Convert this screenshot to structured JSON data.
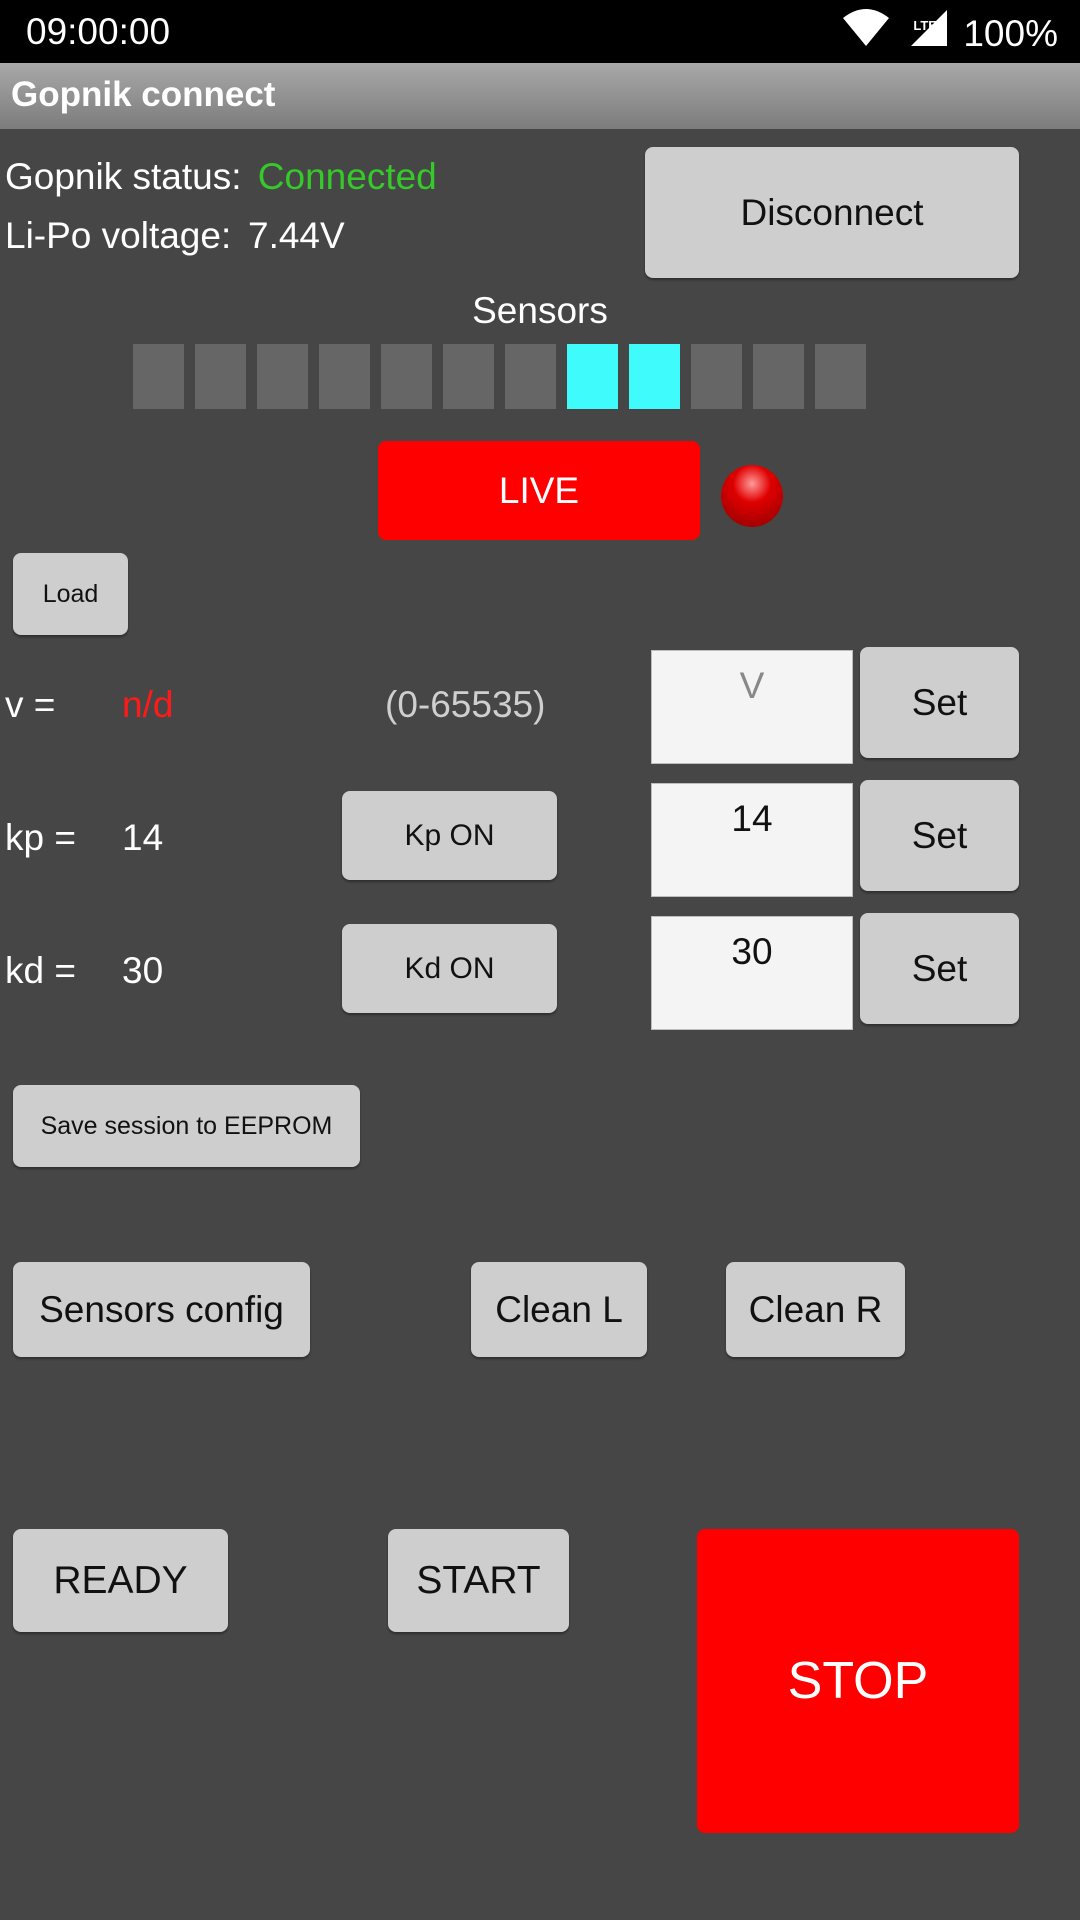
{
  "status_bar": {
    "time": "09:00:00",
    "network": "LTE",
    "battery": "100%",
    "icons": [
      "wifi-icon",
      "signal-icon"
    ]
  },
  "app": {
    "title": "Gopnik connect"
  },
  "info": {
    "status_label": "Gopnik status:",
    "status_value": "Connected",
    "voltage_label": "Li-Po voltage:",
    "voltage_value": "7.44V"
  },
  "disconnect_label": "Disconnect",
  "sensors": {
    "title": "Sensors",
    "states": [
      false,
      false,
      false,
      false,
      false,
      false,
      false,
      true,
      true,
      false,
      false,
      false
    ]
  },
  "live": {
    "label": "LIVE",
    "indicator_color": "#e00000"
  },
  "load_label": "Load",
  "params": {
    "v_label": "v =",
    "v_value": "n/d",
    "v_range": "(0-65535)",
    "v_placeholder": "V",
    "kp_label": "kp =",
    "kp_value": "14",
    "kp_toggle": "Kp ON",
    "kp_input": "14",
    "kd_label": "kd =",
    "kd_value": "30",
    "kd_toggle": "Kd ON",
    "kd_input": "30",
    "set_label": "Set"
  },
  "save_label": "Save session to EEPROM",
  "sensors_config_label": "Sensors config",
  "clean_l_label": "Clean L",
  "clean_r_label": "Clean R",
  "ready_label": "READY",
  "start_label": "START",
  "stop_label": "STOP",
  "colors": {
    "background": "#464646",
    "connected": "#36c92a",
    "nd": "#ff1a1a",
    "sensor_on": "#3ffbfc",
    "sensor_off": "#666666",
    "alert": "#ff0000"
  }
}
